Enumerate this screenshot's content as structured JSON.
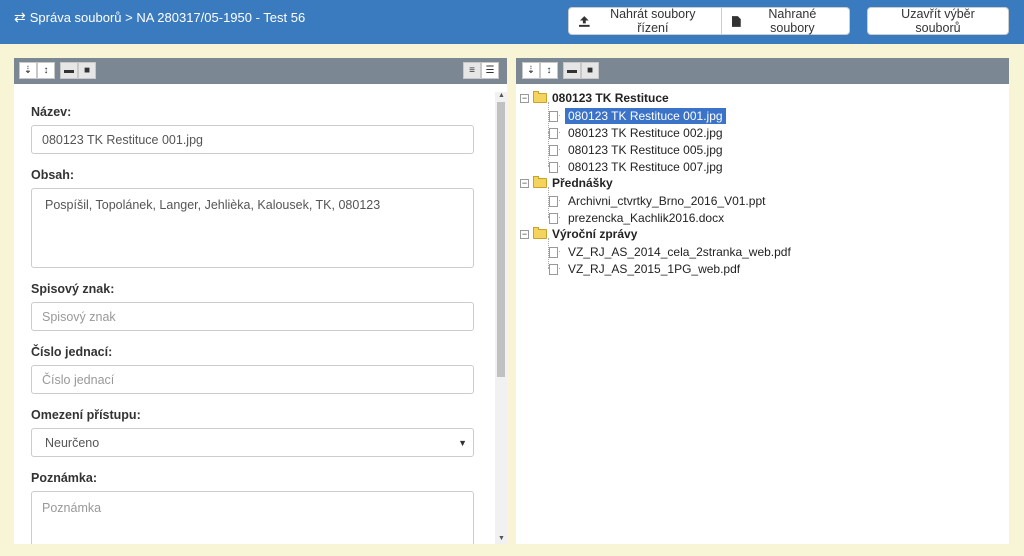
{
  "header": {
    "breadcrumb_icon": "exchange-arrows-icon",
    "breadcrumb": "Správa souborů > NA 280317/05-1950 - Test 56",
    "btn_upload": "Nahrát soubory řízení",
    "btn_uploaded": "Nahrané soubory",
    "btn_close": "Uzavřít výběr souborů"
  },
  "form": {
    "name_label": "Název:",
    "name_value": "080123 TK Restituce 001.jpg",
    "content_label": "Obsah:",
    "content_value": "Pospíšil, Topolánek, Langer, Jehlièka, Kalousek, TK, 080123",
    "file_mark_label": "Spisový znak:",
    "file_mark_placeholder": "Spisový znak",
    "ref_no_label": "Číslo jednací:",
    "ref_no_placeholder": "Číslo jednací",
    "access_label": "Omezení přístupu:",
    "access_value": "Neurčeno",
    "note_label": "Poznámka:",
    "note_placeholder": "Poznámka"
  },
  "tree": {
    "folders": [
      {
        "name": "080123 TK Restituce",
        "files": [
          "080123 TK Restituce 001.jpg",
          "080123 TK Restituce 002.jpg",
          "080123 TK Restituce 005.jpg",
          "080123 TK Restituce 007.jpg"
        ]
      },
      {
        "name": "Přednášky",
        "files": [
          "Archivni_ctvrtky_Brno_2016_V01.ppt",
          "prezencka_Kachlik2016.docx"
        ]
      },
      {
        "name": "Výroční zprávy",
        "files": [
          "VZ_RJ_AS_2014_cela_2stranka_web.pdf",
          "VZ_RJ_AS_2015_1PG_web.pdf"
        ]
      }
    ],
    "selected": "080123 TK Restituce 001.jpg"
  },
  "colors": {
    "header_bg": "#3a7bbf",
    "page_bg": "#f7f5d6",
    "toolbar_bg": "#7b8894",
    "selected_bg": "#3b73c9"
  }
}
